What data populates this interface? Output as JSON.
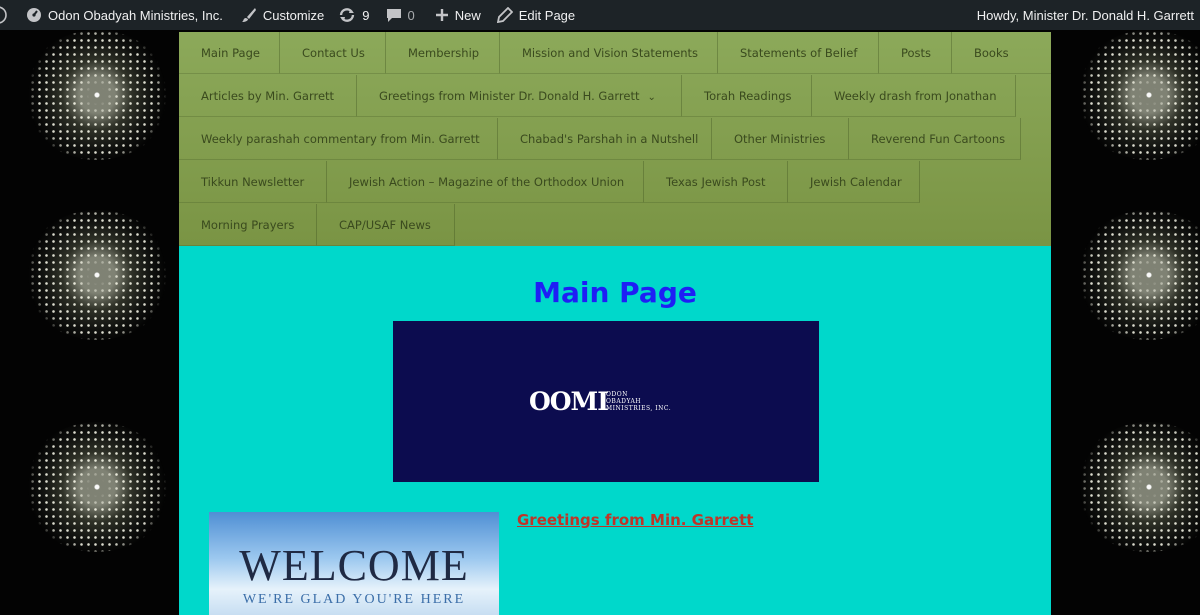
{
  "adminbar": {
    "site_name": "Odon Obadyah Ministries, Inc.",
    "customize": "Customize",
    "updates_count": "9",
    "comments_count": "0",
    "new_label": "New",
    "edit_page": "Edit Page",
    "howdy": "Howdy, Minister Dr. Donald H. Garrett"
  },
  "nav": {
    "items": [
      "Main Page",
      "Contact Us",
      "Membership",
      "Mission and Vision Statements",
      "Statements of Belief",
      "Posts",
      "Books",
      "Articles by Min. Garrett",
      "Greetings from Minister Dr. Donald H. Garrett",
      "Torah Readings",
      "Weekly drash from Jonathan",
      "Weekly parashah commentary from Min. Garrett",
      "Chabad's Parshah in a Nutshell",
      "Other Ministries",
      "Reverend Fun Cartoons",
      "Tikkun Newsletter",
      "Jewish Action – Magazine of the Orthodox Union",
      "Texas Jewish Post",
      "Jewish Calendar",
      "Morning Prayers",
      "CAP/USAF News"
    ]
  },
  "content": {
    "title": "Main Page",
    "logo_mark": "OOMI",
    "logo_sub": [
      "ODON",
      "OBADYAH",
      "MINISTRIES, INC."
    ],
    "welcome_title": "WELCOME",
    "welcome_sub": "WE'RE GLAD YOU'RE HERE",
    "greeting_link": "Greetings from Min. Garrett"
  },
  "colors": {
    "nav_bg": "#829e4e",
    "content_bg": "#00d8cb",
    "title": "#1e1ff5",
    "link": "#c03427",
    "banner": "#0c0c4f"
  }
}
